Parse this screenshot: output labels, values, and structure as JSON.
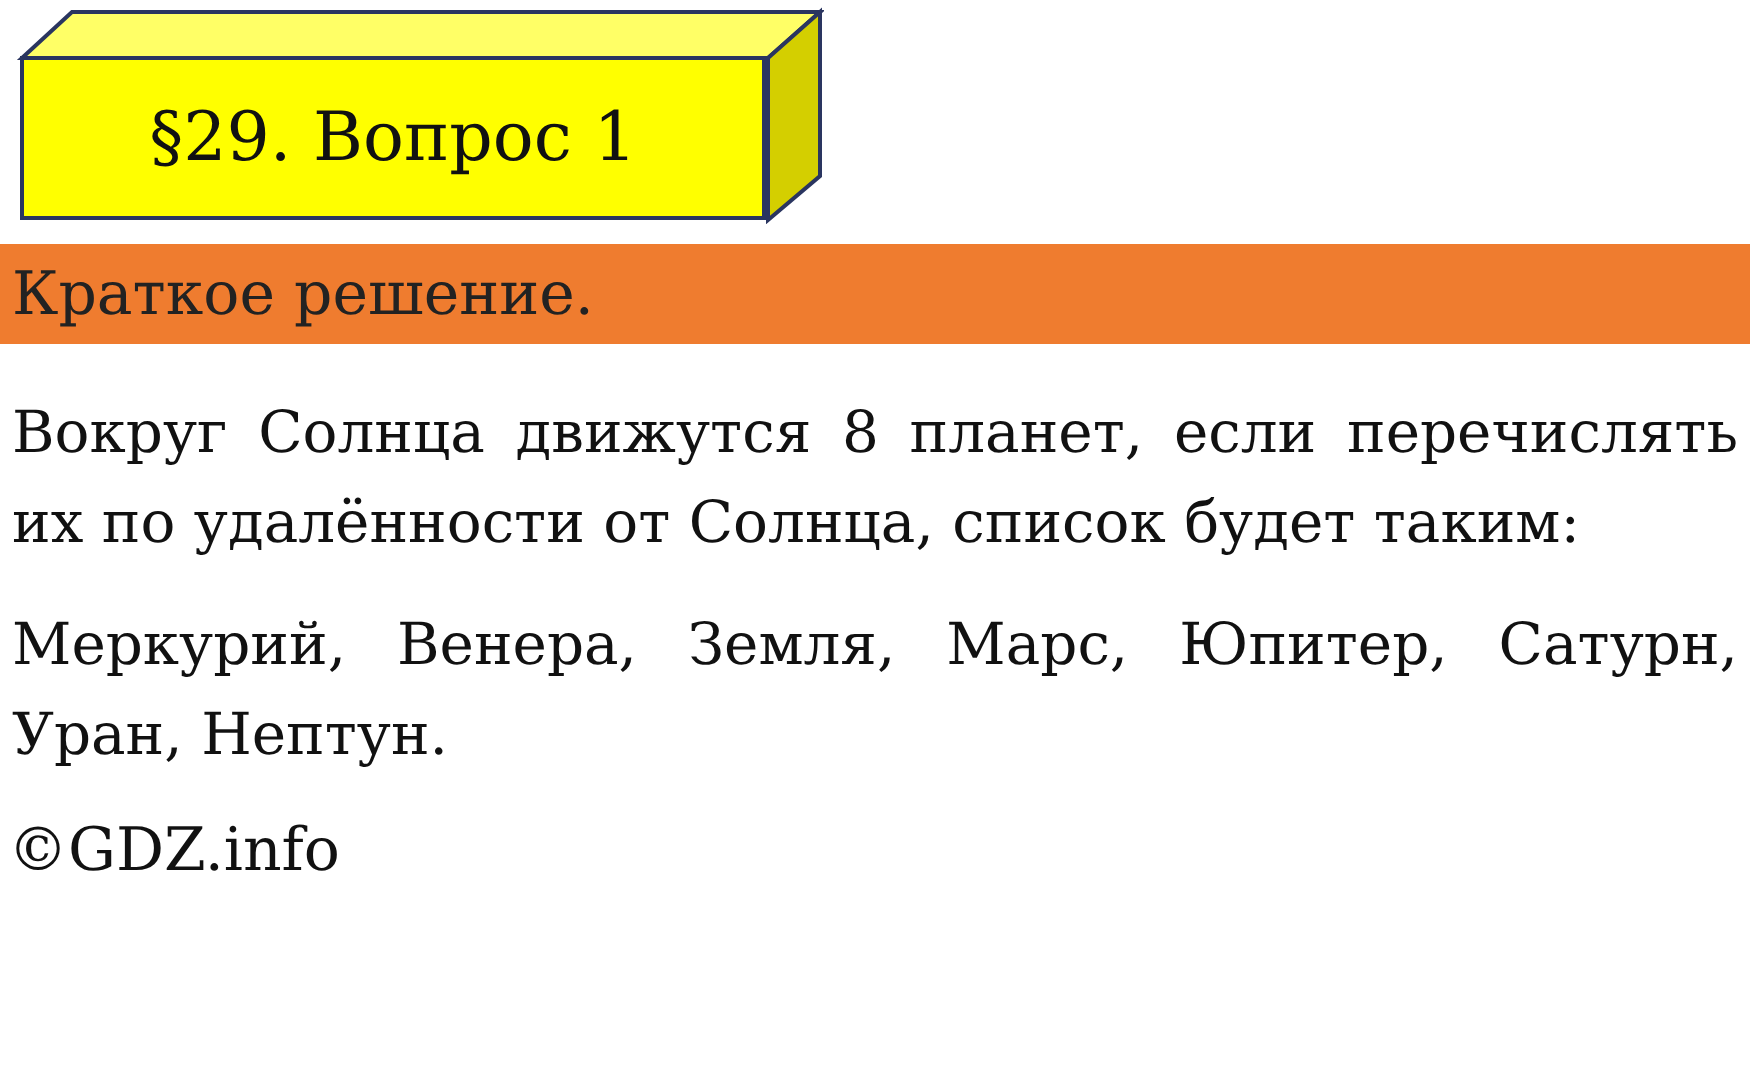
{
  "title": "§29. Вопрос 1",
  "section_bar": "Краткое решение.",
  "paragraphs": [
    "Вокруг Солнца движутся 8 планет, если перечислять их по удалённости от Солнца, список будет таким:",
    "Меркурий, Венера, Земля, Марс, Юпитер, Сатурн, Уран, Нептун."
  ],
  "footer": "©GDZ.info"
}
